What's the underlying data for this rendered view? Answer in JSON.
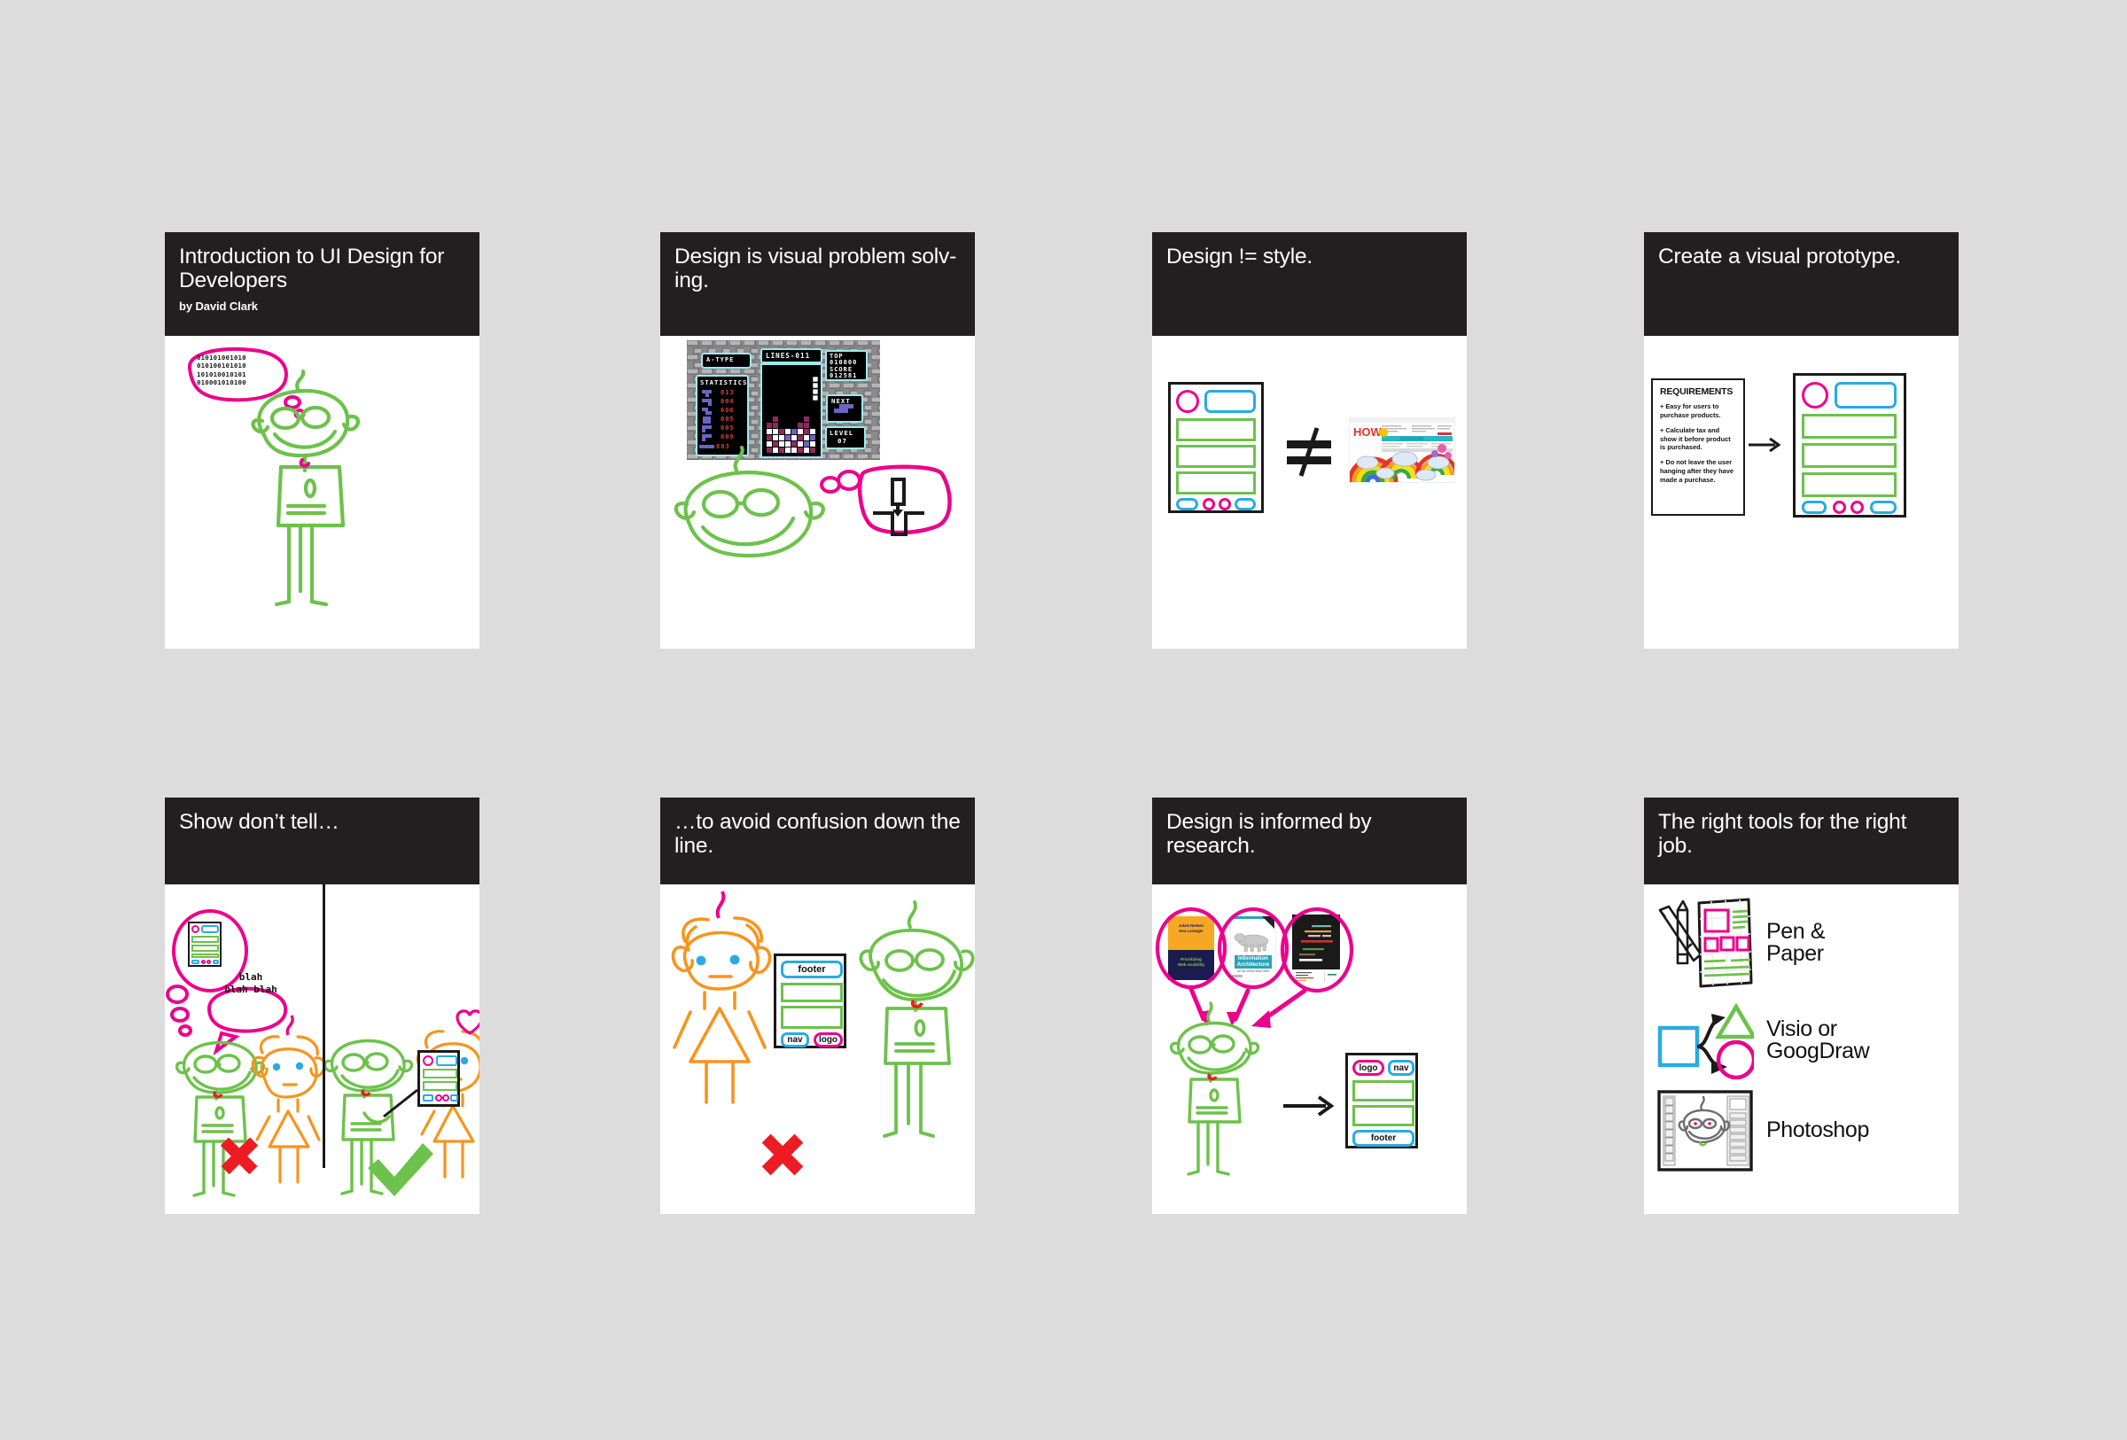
{
  "document": {
    "kind": "slide-deck-contact-sheet",
    "background_color": "#dcdcdc",
    "slide_background": "#ffffff",
    "header_color": "#231f20",
    "header_text_color": "#ffffff",
    "accent_colors": {
      "pink": "#ec008c",
      "green": "#6cc24a",
      "blue": "#29abe2",
      "orange": "#f7941e",
      "red": "#ed1c24",
      "black": "#1a1a1a"
    }
  },
  "slides": [
    {
      "index": 1,
      "title": "Introduction to UI Design for\nDevelopers",
      "subtitle": "by David Clark",
      "binary_bubble": "010101001010\n010100101010\n101010010101\n010001010100",
      "figure": "green-stick-developer"
    },
    {
      "index": 2,
      "title": "Design is visual problem solv-\ning.",
      "game": {
        "name": "tetris",
        "mode": "A-TYPE",
        "lines_label": "LINES-011",
        "top_label": "TOP",
        "top_value": "010000",
        "score_label": "SCORE",
        "score_value": "012581",
        "next_label": "NEXT",
        "level_label": "LEVEL",
        "level_value": "07",
        "statistics_label": "STATISTICS",
        "statistics": [
          "013",
          "004",
          "006",
          "005",
          "005",
          "009",
          "003"
        ]
      },
      "figure": "green-face-with-thought-bubble"
    },
    {
      "index": 3,
      "title": "Design != style.",
      "comparison": {
        "left": "wireframe",
        "operator": "not-equal",
        "right": "HOW magazine rainbow website"
      },
      "magazine_wordmark": "HOW"
    },
    {
      "index": 4,
      "title": "Create a visual prototype.",
      "requirements": {
        "heading": "REQUIREMENTS",
        "items": [
          "+ Easy for users to purchase products.",
          "+ Calculate tax and show it before product is purchased.",
          "+ Do not leave the user hanging after they have made a purchase."
        ]
      },
      "arrow": "right-arrow",
      "result": "wireframe"
    },
    {
      "index": 5,
      "title": "Show don’t tell…",
      "left_panel": {
        "speech": "blah\nblah blah",
        "verdict": "cross",
        "verdict_color": "#ed1c24"
      },
      "right_panel": {
        "verdict": "check",
        "verdict_color": "#6cc24a",
        "heart": true
      }
    },
    {
      "index": 6,
      "title": "…to avoid confusion down the\nline.",
      "wireframe_labels": {
        "top": "footer",
        "bottom_left": "nav",
        "bottom_right": "logo"
      },
      "verdict": "cross",
      "verdict_color": "#ed1c24"
    },
    {
      "index": 7,
      "title": "Design is informed by\nresearch.",
      "books": [
        {
          "authors": "Jakob Nielsen\nHoa Loranger",
          "title": "Prioritizing\nWeb Usability",
          "cover_top_color": "#f7a823",
          "cover_bottom_color": "#1b1b50"
        },
        {
          "title": "Information\nArchitecture",
          "subtitle": "for the World Wide Web",
          "publisher": "O'REILLY",
          "cover_color": "#ffffff",
          "accent": "#2aa3b8"
        },
        {
          "title": "dark-cover-book",
          "cover_color": "#1a1a1a"
        }
      ],
      "wireframe_labels": {
        "top_left": "logo",
        "top_right": "nav",
        "bottom": "footer"
      },
      "arrow": "right-arrow"
    },
    {
      "index": 8,
      "title": "The right tools for the right job.",
      "tools": [
        {
          "name": "Pen &\nPaper",
          "icon": "pencil-and-paper-sketch-icon"
        },
        {
          "name": "Visio or\nGoogDraw",
          "icon": "flowchart-shapes-icon"
        },
        {
          "name": "Photoshop",
          "icon": "photoshop-window-icon"
        }
      ]
    }
  ]
}
